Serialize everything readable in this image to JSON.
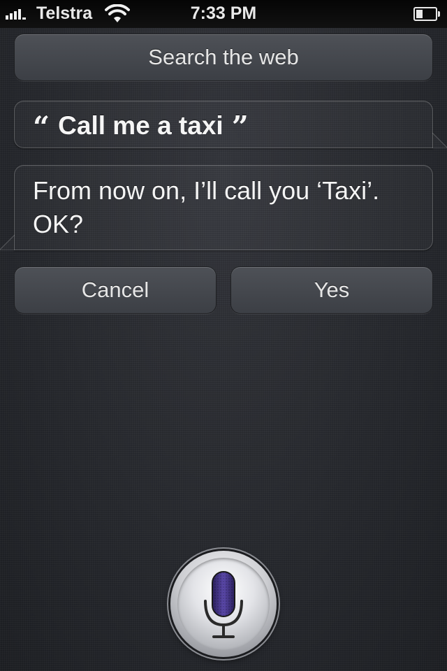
{
  "status_bar": {
    "carrier": "Telstra",
    "time": "7:33 PM",
    "signal_bars": 4,
    "battery_level": 0.35,
    "wifi_icon": "wifi-icon",
    "battery_icon": "battery-icon"
  },
  "search_web": {
    "label": "Search the web"
  },
  "user_query": {
    "open_quote": "“",
    "text": "Call me a taxi",
    "close_quote": "”"
  },
  "siri_response": {
    "text": "From now on, I’ll call you ‘Taxi’. OK?"
  },
  "actions": {
    "cancel_label": "Cancel",
    "yes_label": "Yes"
  },
  "mic": {
    "icon": "microphone-icon",
    "accent_color": "#3a2a7a"
  }
}
